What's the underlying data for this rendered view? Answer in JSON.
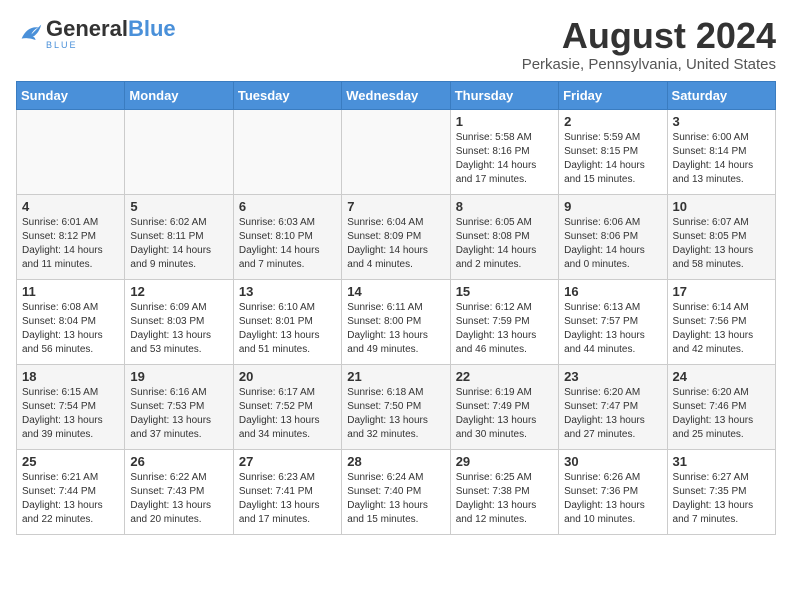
{
  "header": {
    "logo_name": "GeneralBlue",
    "logo_tagline": "Blue",
    "month_year": "August 2024",
    "location": "Perkasie, Pennsylvania, United States"
  },
  "days_of_week": [
    "Sunday",
    "Monday",
    "Tuesday",
    "Wednesday",
    "Thursday",
    "Friday",
    "Saturday"
  ],
  "weeks": [
    [
      {
        "day": "",
        "info": ""
      },
      {
        "day": "",
        "info": ""
      },
      {
        "day": "",
        "info": ""
      },
      {
        "day": "",
        "info": ""
      },
      {
        "day": "1",
        "info": "Sunrise: 5:58 AM\nSunset: 8:16 PM\nDaylight: 14 hours\nand 17 minutes."
      },
      {
        "day": "2",
        "info": "Sunrise: 5:59 AM\nSunset: 8:15 PM\nDaylight: 14 hours\nand 15 minutes."
      },
      {
        "day": "3",
        "info": "Sunrise: 6:00 AM\nSunset: 8:14 PM\nDaylight: 14 hours\nand 13 minutes."
      }
    ],
    [
      {
        "day": "4",
        "info": "Sunrise: 6:01 AM\nSunset: 8:12 PM\nDaylight: 14 hours\nand 11 minutes."
      },
      {
        "day": "5",
        "info": "Sunrise: 6:02 AM\nSunset: 8:11 PM\nDaylight: 14 hours\nand 9 minutes."
      },
      {
        "day": "6",
        "info": "Sunrise: 6:03 AM\nSunset: 8:10 PM\nDaylight: 14 hours\nand 7 minutes."
      },
      {
        "day": "7",
        "info": "Sunrise: 6:04 AM\nSunset: 8:09 PM\nDaylight: 14 hours\nand 4 minutes."
      },
      {
        "day": "8",
        "info": "Sunrise: 6:05 AM\nSunset: 8:08 PM\nDaylight: 14 hours\nand 2 minutes."
      },
      {
        "day": "9",
        "info": "Sunrise: 6:06 AM\nSunset: 8:06 PM\nDaylight: 14 hours\nand 0 minutes."
      },
      {
        "day": "10",
        "info": "Sunrise: 6:07 AM\nSunset: 8:05 PM\nDaylight: 13 hours\nand 58 minutes."
      }
    ],
    [
      {
        "day": "11",
        "info": "Sunrise: 6:08 AM\nSunset: 8:04 PM\nDaylight: 13 hours\nand 56 minutes."
      },
      {
        "day": "12",
        "info": "Sunrise: 6:09 AM\nSunset: 8:03 PM\nDaylight: 13 hours\nand 53 minutes."
      },
      {
        "day": "13",
        "info": "Sunrise: 6:10 AM\nSunset: 8:01 PM\nDaylight: 13 hours\nand 51 minutes."
      },
      {
        "day": "14",
        "info": "Sunrise: 6:11 AM\nSunset: 8:00 PM\nDaylight: 13 hours\nand 49 minutes."
      },
      {
        "day": "15",
        "info": "Sunrise: 6:12 AM\nSunset: 7:59 PM\nDaylight: 13 hours\nand 46 minutes."
      },
      {
        "day": "16",
        "info": "Sunrise: 6:13 AM\nSunset: 7:57 PM\nDaylight: 13 hours\nand 44 minutes."
      },
      {
        "day": "17",
        "info": "Sunrise: 6:14 AM\nSunset: 7:56 PM\nDaylight: 13 hours\nand 42 minutes."
      }
    ],
    [
      {
        "day": "18",
        "info": "Sunrise: 6:15 AM\nSunset: 7:54 PM\nDaylight: 13 hours\nand 39 minutes."
      },
      {
        "day": "19",
        "info": "Sunrise: 6:16 AM\nSunset: 7:53 PM\nDaylight: 13 hours\nand 37 minutes."
      },
      {
        "day": "20",
        "info": "Sunrise: 6:17 AM\nSunset: 7:52 PM\nDaylight: 13 hours\nand 34 minutes."
      },
      {
        "day": "21",
        "info": "Sunrise: 6:18 AM\nSunset: 7:50 PM\nDaylight: 13 hours\nand 32 minutes."
      },
      {
        "day": "22",
        "info": "Sunrise: 6:19 AM\nSunset: 7:49 PM\nDaylight: 13 hours\nand 30 minutes."
      },
      {
        "day": "23",
        "info": "Sunrise: 6:20 AM\nSunset: 7:47 PM\nDaylight: 13 hours\nand 27 minutes."
      },
      {
        "day": "24",
        "info": "Sunrise: 6:20 AM\nSunset: 7:46 PM\nDaylight: 13 hours\nand 25 minutes."
      }
    ],
    [
      {
        "day": "25",
        "info": "Sunrise: 6:21 AM\nSunset: 7:44 PM\nDaylight: 13 hours\nand 22 minutes."
      },
      {
        "day": "26",
        "info": "Sunrise: 6:22 AM\nSunset: 7:43 PM\nDaylight: 13 hours\nand 20 minutes."
      },
      {
        "day": "27",
        "info": "Sunrise: 6:23 AM\nSunset: 7:41 PM\nDaylight: 13 hours\nand 17 minutes."
      },
      {
        "day": "28",
        "info": "Sunrise: 6:24 AM\nSunset: 7:40 PM\nDaylight: 13 hours\nand 15 minutes."
      },
      {
        "day": "29",
        "info": "Sunrise: 6:25 AM\nSunset: 7:38 PM\nDaylight: 13 hours\nand 12 minutes."
      },
      {
        "day": "30",
        "info": "Sunrise: 6:26 AM\nSunset: 7:36 PM\nDaylight: 13 hours\nand 10 minutes."
      },
      {
        "day": "31",
        "info": "Sunrise: 6:27 AM\nSunset: 7:35 PM\nDaylight: 13 hours\nand 7 minutes."
      }
    ]
  ]
}
